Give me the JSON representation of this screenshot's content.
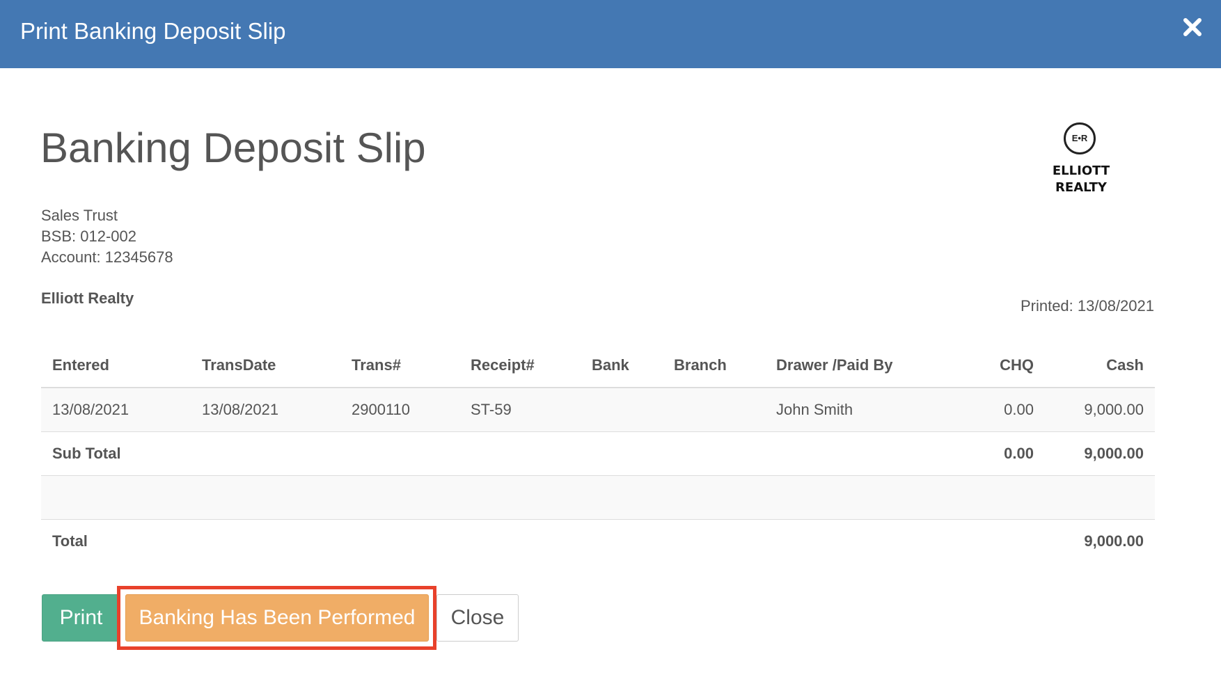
{
  "modal": {
    "title": "Print Banking Deposit Slip",
    "close_icon": "close-icon"
  },
  "document": {
    "title": "Banking Deposit Slip",
    "logo": {
      "monogram": "E•R",
      "name": "ELLIOTT\nREALTY"
    },
    "account": {
      "name": "Sales Trust",
      "bsb": "BSB: 012-002",
      "number": "Account: 12345678"
    },
    "company": "Elliott Realty",
    "printed": "Printed: 13/08/2021"
  },
  "table": {
    "columns": [
      "Entered",
      "TransDate",
      "Trans#",
      "Receipt#",
      "Bank",
      "Branch",
      "Drawer /Paid By",
      "CHQ",
      "Cash"
    ],
    "rows": [
      {
        "entered": "13/08/2021",
        "transdate": "13/08/2021",
        "trans": "2900110",
        "receipt": "ST-59",
        "bank": "",
        "branch": "",
        "drawer": "John Smith",
        "chq": "0.00",
        "cash": "9,000.00"
      }
    ],
    "subtotal": {
      "label": "Sub Total",
      "chq": "0.00",
      "cash": "9,000.00"
    },
    "total": {
      "label": "Total",
      "cash": "9,000.00"
    }
  },
  "buttons": {
    "print": "Print",
    "banking": "Banking Has Been Performed",
    "close": "Close"
  },
  "colors": {
    "header": "#4478b3",
    "print_button": "#52af8e",
    "banking_button": "#f0ad66",
    "highlight": "#e8412b"
  }
}
